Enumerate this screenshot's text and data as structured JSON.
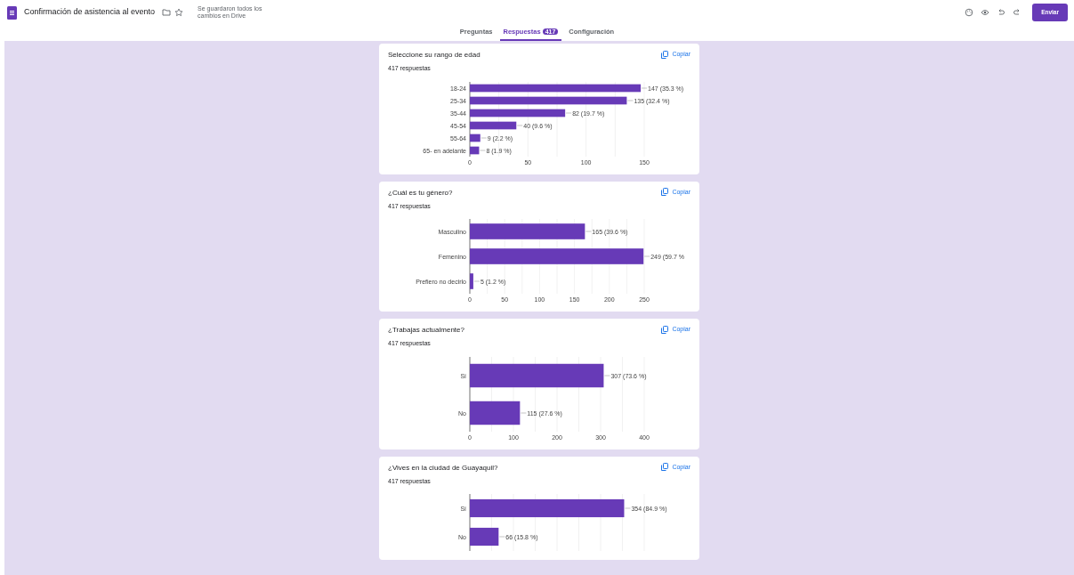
{
  "header": {
    "title": "Confirmación de asistencia al evento",
    "save_status": "Se guardaron todos los cambios en Drive",
    "send_button": "Enviar"
  },
  "tabs": [
    {
      "label": "Preguntas",
      "selected": false
    },
    {
      "label": "Respuestas",
      "selected": true,
      "badge": "417"
    },
    {
      "label": "Configuración",
      "selected": false
    }
  ],
  "questions": [
    {
      "title": "Seleccione su rango de edad",
      "responses": "417 respuestas",
      "copy_button": "Copiar",
      "chart_data": {
        "type": "bar",
        "orientation": "horizontal",
        "categories": [
          "18-24",
          "25-34",
          "35-44",
          "45-54",
          "55-64",
          "65- en adelante"
        ],
        "series": [
          {
            "color": "#673ab7",
            "values": [
              147,
              135,
              82,
              40,
              9,
              8
            ]
          }
        ],
        "grid": true,
        "xlim": [
          0,
          150
        ],
        "xticks": [
          0,
          50,
          100,
          150
        ],
        "value_labels": [
          "147 (35.3 %)",
          "135 (32.4 %)",
          "82 (19.7 %)",
          "40 (9.6 %)",
          "9 (2.2 %)",
          "8 (1.9 %)"
        ]
      }
    },
    {
      "title": "¿Cuál es tu género?",
      "responses": "417 respuestas",
      "copy_button": "Copiar",
      "chart_data": {
        "type": "bar",
        "orientation": "horizontal",
        "categories": [
          "Masculino",
          "Femenino",
          "Prefiero no decirlo"
        ],
        "series": [
          {
            "color": "#673ab7",
            "values": [
              165,
              249,
              5
            ]
          }
        ],
        "grid": true,
        "xlim": [
          0,
          250
        ],
        "xticks": [
          0,
          50,
          100,
          150,
          200,
          250
        ],
        "value_labels": [
          "165 (39.6 %)",
          "249 (59.7 %",
          "5 (1.2 %)"
        ]
      }
    },
    {
      "title": "¿Trabajas actualmente?",
      "responses": "417 respuestas",
      "copy_button": "Copiar",
      "chart_data": {
        "type": "bar",
        "orientation": "horizontal",
        "categories": [
          "Sí",
          "No"
        ],
        "series": [
          {
            "color": "#673ab7",
            "values": [
              307,
              115
            ]
          }
        ],
        "grid": true,
        "xlim": [
          0,
          400
        ],
        "xticks": [
          0,
          100,
          200,
          300,
          400
        ],
        "value_labels": [
          "307 (73.6 %)",
          "115 (27.6 %)"
        ]
      }
    },
    {
      "title": "¿Vives en la ciudad de Guayaquil?",
      "responses": "417 respuestas",
      "copy_button": "Copiar",
      "chart_data": {
        "type": "bar",
        "orientation": "horizontal",
        "categories": [
          "Sí",
          "No"
        ],
        "series": [
          {
            "color": "#673ab7",
            "values": [
              354,
              66
            ]
          }
        ],
        "grid": true,
        "xlim": [
          0,
          400
        ],
        "value_labels": [
          "354 (84.9 %)",
          "66 (15.8 %)"
        ]
      }
    }
  ]
}
